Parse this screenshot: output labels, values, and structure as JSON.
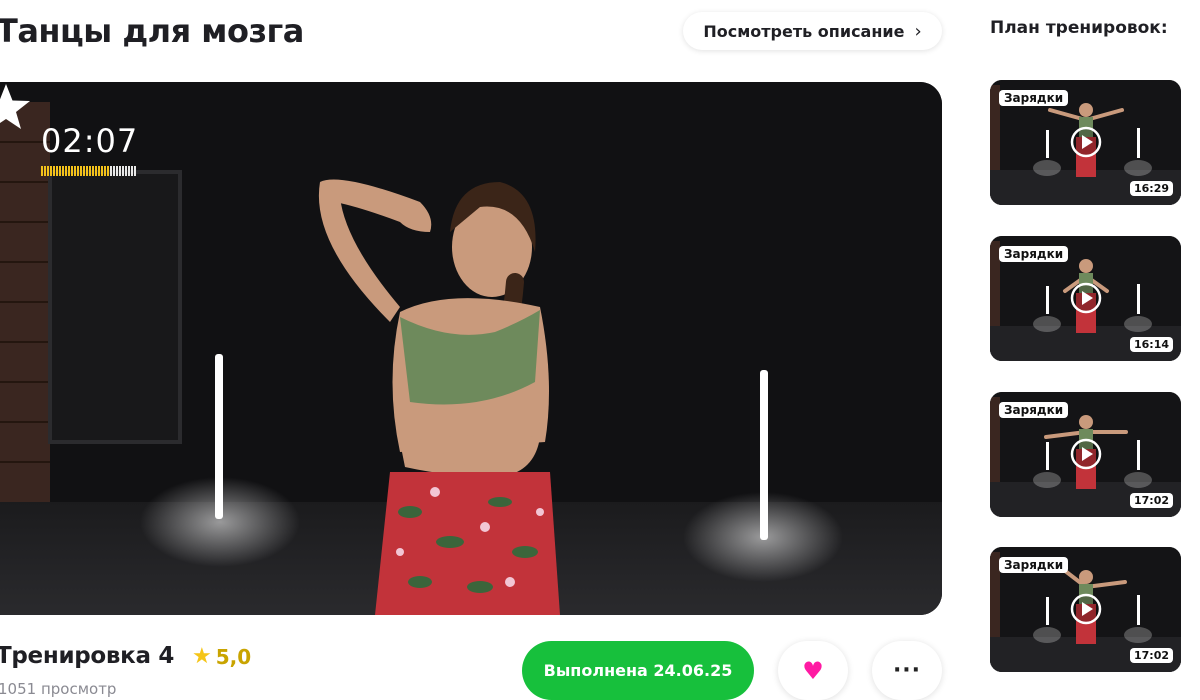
{
  "page": {
    "title": "Танцы для мозга",
    "description_button": "Посмотреть описание",
    "chevron_glyph": "›"
  },
  "player": {
    "timer": "02:07",
    "progress_fraction": 0.72,
    "progress_color": "#f3c21b",
    "remaining_color": "#e8e8e8",
    "favorite_icon": "star-icon"
  },
  "sidebar": {
    "title": "План тренировок:",
    "items": [
      {
        "tag": "Зарядки",
        "duration": "16:29",
        "pose": "arms-out"
      },
      {
        "tag": "Зарядки",
        "duration": "16:14",
        "pose": "squat"
      },
      {
        "tag": "Зарядки",
        "duration": "17:02",
        "pose": "arms-side"
      },
      {
        "tag": "Зарядки",
        "duration": "17:02",
        "pose": "wave"
      }
    ]
  },
  "workout": {
    "title": "Тренировка 4",
    "rating": "5,0",
    "views": "1051 просмотр"
  },
  "actions": {
    "done_label": "Выполнена 24.06.25",
    "like_icon": "heart-icon",
    "more_icon": "more-dots-icon"
  },
  "colors": {
    "accent_green": "#17c03c",
    "like_pink": "#ff1aa3",
    "rating_gold": "#f5c518"
  }
}
